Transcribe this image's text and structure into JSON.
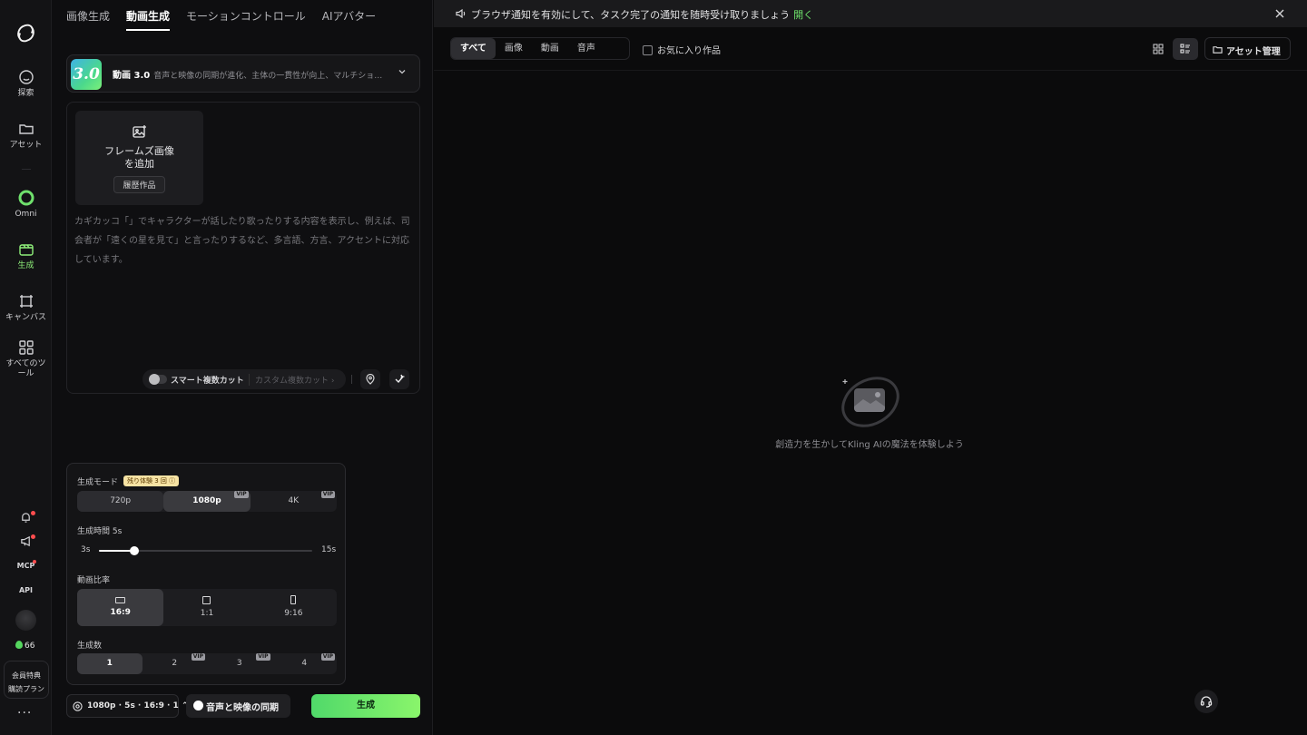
{
  "nav": {
    "items": [
      {
        "label": "探索",
        "icon": "explore-icon"
      },
      {
        "label": "アセット",
        "icon": "folder-icon"
      },
      {
        "label": "Omni",
        "icon": "omni-icon"
      },
      {
        "label": "生成",
        "icon": "generate-icon"
      },
      {
        "label": "キャンバス",
        "icon": "canvas-icon"
      },
      {
        "label": "すべてのツール",
        "icon": "grid-icon"
      }
    ],
    "mcp_label": "MCP",
    "api_label": "API",
    "credits": "66",
    "plan_line1": "会員特典",
    "plan_line2": "購読プラン",
    "more": "···"
  },
  "tabs": [
    {
      "label": "画像生成",
      "active": false
    },
    {
      "label": "動画生成",
      "active": true
    },
    {
      "label": "モーションコントロール",
      "active": false
    },
    {
      "label": "AIアバター",
      "active": false
    }
  ],
  "model": {
    "badge": "3.0",
    "name": "動画 3.0",
    "description": "音声と映像の同期が進化、主体の一貫性が向上、マルチショッ…"
  },
  "prompt": {
    "add_frame_line1": "フレームズ画像",
    "add_frame_line2": "を追加",
    "history_button": "履歴作品",
    "placeholder": "カギカッコ「」でキャラクターが話したり歌ったりする内容を表示し、例えば、司会者が「遠くの星を見て」と言ったりするなど、多言語、方言、アクセントに対応しています。",
    "smart_cut": "スマート複数カット",
    "custom_cut": "カスタム複数カット ›"
  },
  "settings": {
    "mode_label": "生成モード",
    "trial_badge": "残り体験 3 回 ⓘ",
    "resolutions": [
      {
        "label": "720p",
        "vip": false,
        "selected": false
      },
      {
        "label": "1080p",
        "vip": true,
        "selected": true
      },
      {
        "label": "4K",
        "vip": true,
        "selected": false
      }
    ],
    "vip_tag": "VIP",
    "duration_label": "生成時間 5s",
    "duration_min": "3s",
    "duration_max": "15s",
    "duration_value_fraction": 0.167,
    "ratio_label": "動画比率",
    "ratios": [
      {
        "label": "16:9",
        "selected": true
      },
      {
        "label": "1:1",
        "selected": false
      },
      {
        "label": "9:16",
        "selected": false
      }
    ],
    "count_label": "生成数",
    "counts": [
      {
        "label": "1",
        "vip": false,
        "selected": true
      },
      {
        "label": "2",
        "vip": true,
        "selected": false
      },
      {
        "label": "3",
        "vip": true,
        "selected": false
      },
      {
        "label": "4",
        "vip": true,
        "selected": false
      }
    ]
  },
  "footer": {
    "summary": "1080p · 5s · 16:9 · 1 ⌃",
    "sync_button": "音声と映像の同期",
    "generate_button": "生成"
  },
  "workspace": {
    "notice_text": "ブラウザ通知を有効にして、タスク完了の通知を随時受け取りましょう",
    "notice_open": "開く",
    "filters": [
      {
        "label": "すべて",
        "selected": true
      },
      {
        "label": "画像",
        "selected": false
      },
      {
        "label": "動画",
        "selected": false
      },
      {
        "label": "音声",
        "selected": false
      }
    ],
    "favorites_label": "お気に入り作品",
    "asset_button": "アセット管理",
    "empty_text": "創造力を生かしてKling AIの魔法を体験しよう"
  },
  "colors": {
    "accent_green": "#8af56b",
    "background": "#0b0b0c"
  }
}
